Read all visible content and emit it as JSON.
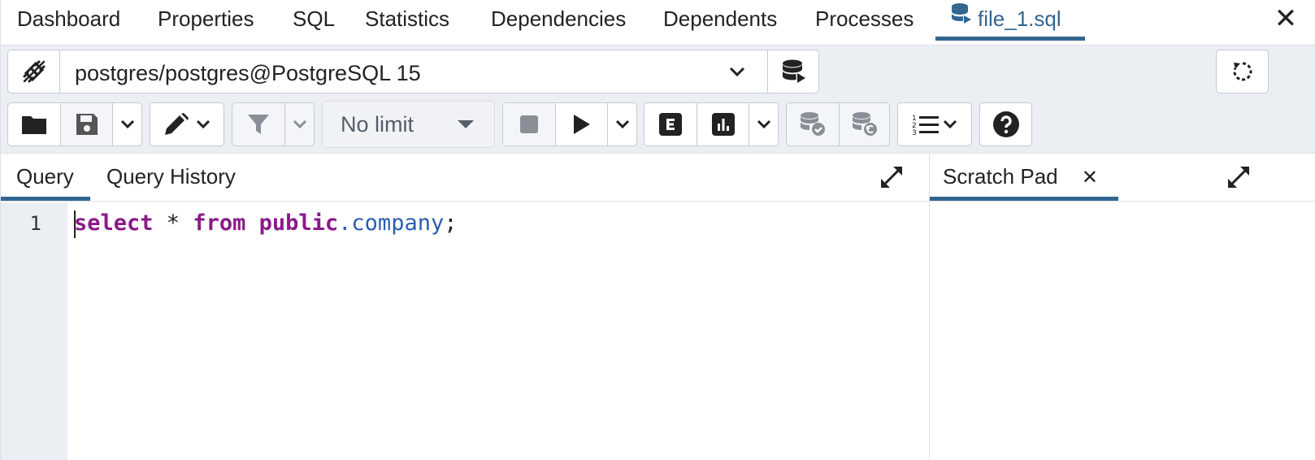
{
  "top_tabs": [
    {
      "label": "Dashboard"
    },
    {
      "label": "Properties"
    },
    {
      "label": "SQL"
    },
    {
      "label": "Statistics"
    },
    {
      "label": "Dependencies"
    },
    {
      "label": "Dependents"
    },
    {
      "label": "Processes"
    },
    {
      "label": "file_1.sql",
      "active": true,
      "icon": "database-icon"
    }
  ],
  "connection": {
    "value": "postgres/postgres@PostgreSQL 15"
  },
  "toolbar": {
    "limit_value": "No limit"
  },
  "editor_tabs": {
    "query": "Query",
    "history": "Query History",
    "scratch": "Scratch Pad",
    "scratch_close": "✕"
  },
  "editor": {
    "line_number": "1",
    "tokens": {
      "kw1": "select",
      "star": " * ",
      "kw2": "from",
      "schema": " public",
      "dot": ".",
      "table": "company",
      "semi": ";"
    }
  },
  "colors": {
    "accent": "#326690",
    "keyword": "#8a1a8a",
    "identifier": "#2a5db0",
    "toolbar_bg": "#ebeef3"
  },
  "window": {
    "close": "✕"
  }
}
